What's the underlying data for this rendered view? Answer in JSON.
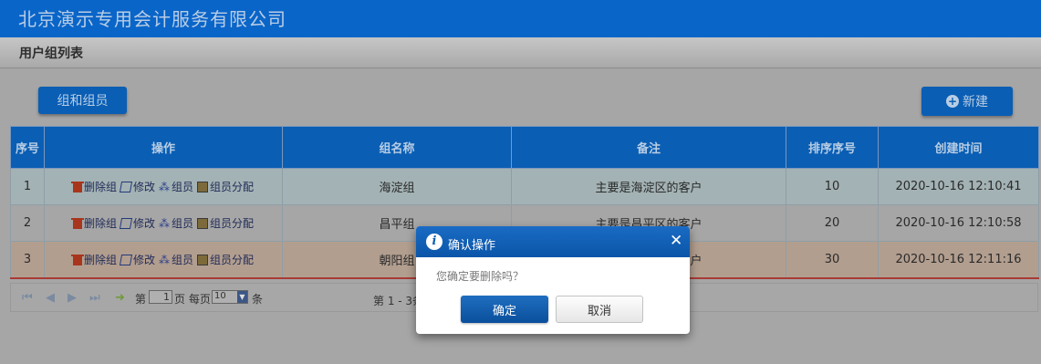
{
  "app": {
    "title": "北京演示专用会计服务有限公司"
  },
  "page": {
    "title": "用户组列表"
  },
  "toolbar": {
    "group_members_label": "组和组员",
    "new_label": "新建"
  },
  "table": {
    "headers": [
      "序号",
      "操作",
      "组名称",
      "备注",
      "排序序号",
      "创建时间"
    ],
    "actions": {
      "delete": "删除组",
      "edit": "修改",
      "members": "组员",
      "assign": "组员分配"
    },
    "rows": [
      {
        "seq": "1",
        "name": "海淀组",
        "remark": "主要是海淀区的客户",
        "order": "10",
        "created": "2020-10-16 12:10:41"
      },
      {
        "seq": "2",
        "name": "昌平组",
        "remark": "主要是昌平区的客户",
        "order": "20",
        "created": "2020-10-16 12:10:58"
      },
      {
        "seq": "3",
        "name": "朝阳组",
        "remark": "主要是朝阳区的客户",
        "order": "30",
        "created": "2020-10-16 12:11:16"
      }
    ]
  },
  "pager": {
    "page_prefix": "第",
    "page_value": "1",
    "page_suffix": "页 每页",
    "page_size": "10",
    "rows_suffix": "条",
    "info": "第 1 - 3条"
  },
  "dialog": {
    "title": "确认操作",
    "message": "您确定要删除吗？",
    "ok_label": "确定",
    "cancel_label": "取消",
    "close_symbol": "✕"
  }
}
